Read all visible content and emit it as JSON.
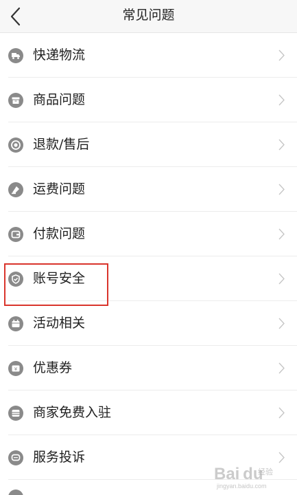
{
  "header": {
    "title": "常见问题",
    "back_icon": "chevron-left-icon"
  },
  "items": [
    {
      "label": "快递物流",
      "icon": "truck-icon"
    },
    {
      "label": "商品问题",
      "icon": "box-icon"
    },
    {
      "label": "退款/售后",
      "icon": "refund-icon"
    },
    {
      "label": "运费问题",
      "icon": "shipping-fee-icon"
    },
    {
      "label": "付款问题",
      "icon": "wallet-icon"
    },
    {
      "label": "账号安全",
      "icon": "shield-icon",
      "highlighted": true
    },
    {
      "label": "活动相关",
      "icon": "calendar-icon"
    },
    {
      "label": "优惠券",
      "icon": "coupon-icon"
    },
    {
      "label": "商家免费入驻",
      "icon": "store-icon"
    },
    {
      "label": "服务投诉",
      "icon": "chat-icon"
    }
  ],
  "watermark": {
    "logo": "Bai du",
    "sub": "经验",
    "url": "jingyan.baidu.com"
  },
  "colors": {
    "icon_gray": "#8a8a8a",
    "highlight_border": "#d9342b",
    "text": "#1f1f1f",
    "chevron": "#c4c4c4"
  }
}
